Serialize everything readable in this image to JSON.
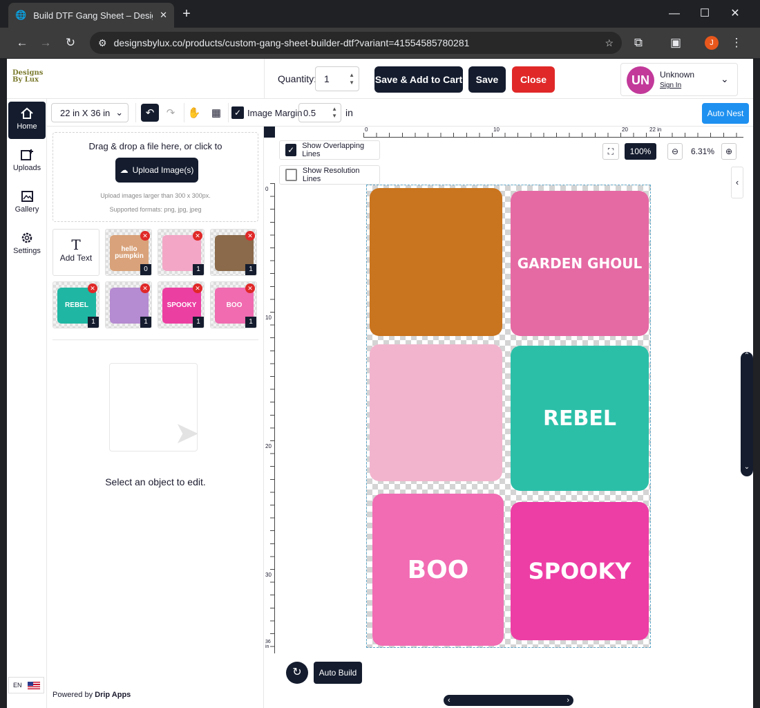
{
  "browser": {
    "tab_title": "Build DTF Gang Sheet – Designs",
    "url": "designsbylux.co/products/custom-gang-sheet-builder-dtf?variant=41554585780281",
    "profile_initial": "J"
  },
  "header": {
    "logo_text": "Designs By Lux",
    "quantity_label": "Quantity:",
    "quantity_value": "1",
    "save_add_cart": "Save & Add to Cart",
    "save": "Save",
    "close": "Close",
    "user_initials": "UN",
    "user_name": "Unknown",
    "sign_in": "Sign In"
  },
  "sidenav": {
    "items": [
      {
        "label": "Home",
        "active": true
      },
      {
        "label": "Uploads"
      },
      {
        "label": "Gallery"
      },
      {
        "label": "Settings"
      }
    ],
    "language": "EN"
  },
  "toolbar": {
    "sheet_size": "22 in X 36 in",
    "image_margin_label": "Image Margin",
    "image_margin_value": "0.5",
    "unit": "in",
    "auto_nest": "Auto Nest"
  },
  "uploads": {
    "drop_title": "Drag & drop a file here, or click to",
    "upload_button": "Upload Image(s)",
    "hint_size": "Upload images larger than 300 x 300px.",
    "hint_formats": "Supported formats: png, jpg, jpeg",
    "add_text": "Add Text",
    "thumbnails": [
      {
        "label": "hello pumpkin",
        "count": "0",
        "color": "#d9a27a"
      },
      {
        "label": "",
        "count": "1",
        "color": "#f3a6c6"
      },
      {
        "label": "",
        "count": "1",
        "color": "#8a6a4a"
      },
      {
        "label": "REBEL",
        "count": "1",
        "color": "#1fb7a3"
      },
      {
        "label": "",
        "count": "1",
        "color": "#b58bd1"
      },
      {
        "label": "SPOOKY",
        "count": "1",
        "color": "#ec3fa2"
      },
      {
        "label": "BOO",
        "count": "1",
        "color": "#f06bb0"
      }
    ],
    "empty_message": "Select an object to edit.",
    "powered_by": "Powered by",
    "powered_brand": "Drip Apps"
  },
  "canvas": {
    "show_overlapping_lines": "Show Overlapping Lines",
    "show_resolution_lines": "Show Resolution Lines",
    "zoom_fit": "100%",
    "zoom_level": "6.31%",
    "ruler_top_labels": [
      "0",
      "10",
      "20",
      "22 in"
    ],
    "ruler_left_labels": [
      "0",
      "10",
      "20",
      "30",
      "36 in"
    ],
    "designs": [
      {
        "label": "",
        "color": "#c9741e"
      },
      {
        "label": "GARDEN GHOUL",
        "color": "#e56aa4"
      },
      {
        "label": "",
        "color": "#f2b4cd"
      },
      {
        "label": "REBEL",
        "color": "#2cbfa8"
      },
      {
        "label": "BOO",
        "color": "#f16cb3"
      },
      {
        "label": "SPOOKY",
        "color": "#ed3ea5"
      }
    ],
    "auto_build": "Auto Build"
  }
}
